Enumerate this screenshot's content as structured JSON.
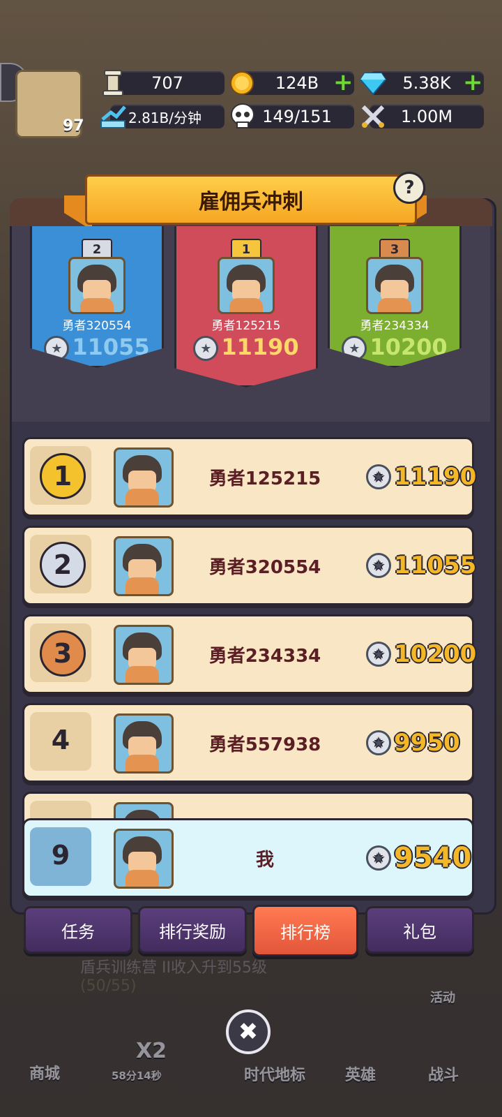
{
  "resources": {
    "stone": "707",
    "coins": "124B",
    "gems": "5.38K",
    "income": "2.81B/分钟",
    "population": "149/151",
    "power": "1.00M"
  },
  "player_level": "97",
  "x2_badge": "x2",
  "event": {
    "title": "雇佣兵冲刺",
    "help": "?"
  },
  "podium": [
    {
      "rank": "2",
      "name": "勇者320554",
      "score": "11055",
      "color": "#3b8fd6"
    },
    {
      "rank": "1",
      "name": "勇者125215",
      "score": "11190",
      "color": "#d14c5a"
    },
    {
      "rank": "3",
      "name": "勇者234334",
      "score": "10200",
      "color": "#7cae2f"
    }
  ],
  "leaderboard": [
    {
      "rank": "1",
      "name": "勇者125215",
      "score": "11190"
    },
    {
      "rank": "2",
      "name": "勇者320554",
      "score": "11055"
    },
    {
      "rank": "3",
      "name": "勇者234334",
      "score": "10200"
    },
    {
      "rank": "4",
      "name": "勇者557938",
      "score": "9950"
    }
  ],
  "me": {
    "rank": "9",
    "name": "我",
    "score": "9540"
  },
  "tabs": [
    "任务",
    "排行奖励",
    "排行榜",
    "礼包"
  ],
  "active_tab": "排行榜",
  "quest": {
    "text": "盾兵训练营 II收入升到55级",
    "progress": "(50/55)"
  },
  "bottom_nav": {
    "shop": "商城",
    "timer": "58分14秒",
    "x2": "X2",
    "landmark": "时代地标",
    "heroes": "英雄",
    "battle": "战斗",
    "activity": "活动"
  },
  "close_icon": "✖"
}
